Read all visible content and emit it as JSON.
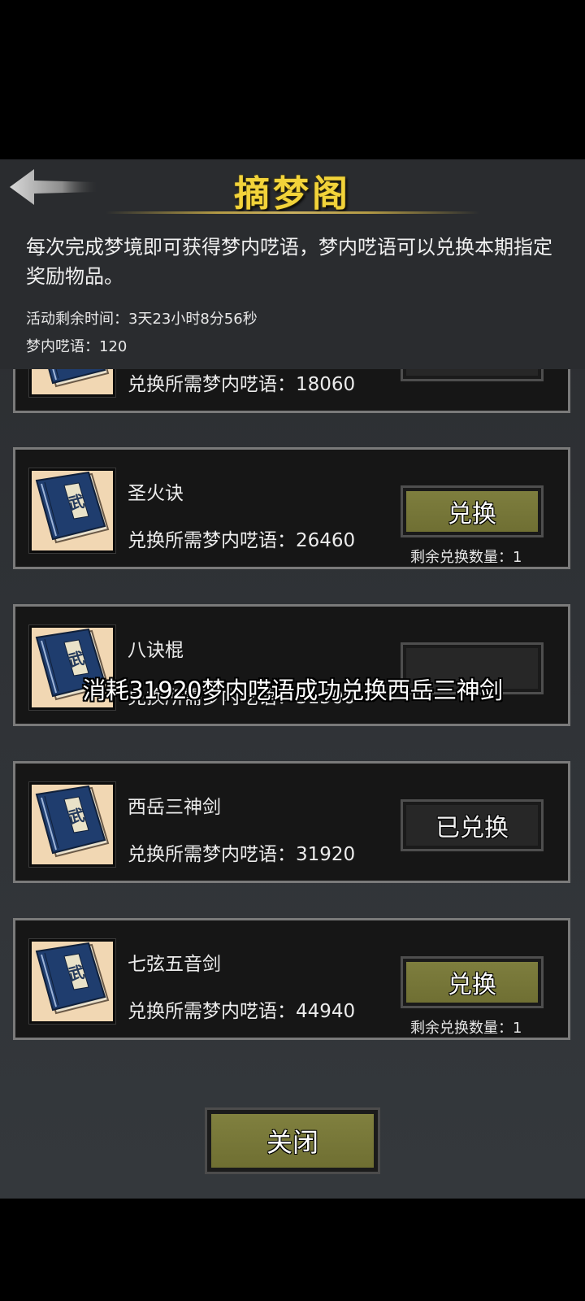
{
  "header": {
    "title": "摘梦阁",
    "description": "每次完成梦境即可获得梦内呓语，梦内呓语可以兑换本期指定奖励物品。",
    "time_label": "活动剩余时间：3天23小时8分56秒",
    "currency_label": "梦内呓语：120"
  },
  "items": [
    {
      "name": "",
      "cost": "兑换所需梦内呓语：18060",
      "button": "",
      "remaining": ""
    },
    {
      "name": "圣火诀",
      "cost": "兑换所需梦内呓语：26460",
      "button": "兑换",
      "remaining": "剩余兑换数量：1"
    },
    {
      "name": "八诀棍",
      "cost": "兑换所需梦内呓语：31500",
      "button": "",
      "remaining": ""
    },
    {
      "name": "西岳三神剑",
      "cost": "兑换所需梦内呓语：31920",
      "button": "已兑换",
      "remaining": ""
    },
    {
      "name": "七弦五音剑",
      "cost": "兑换所需梦内呓语：44940",
      "button": "兑换",
      "remaining": "剩余兑换数量：1"
    }
  ],
  "book_icon_glyph": "武",
  "toast": "消耗31920梦内呓语成功兑换西岳三神剑",
  "close_label": "关闭",
  "colors": {
    "title_gold": "#f2d33a",
    "button_olive": "#7e7e3e",
    "card_border": "#7a7a7a",
    "book_blue": "#1f3d6e"
  }
}
